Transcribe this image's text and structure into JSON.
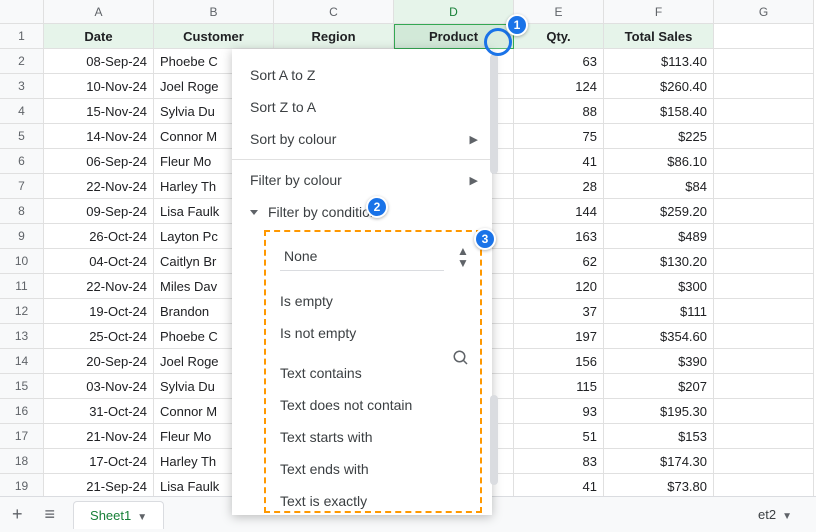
{
  "columns": [
    "A",
    "B",
    "C",
    "D",
    "E",
    "F",
    "G"
  ],
  "headers": {
    "date": "Date",
    "customer": "Customer",
    "region": "Region",
    "product": "Product",
    "qty": "Qty.",
    "total": "Total Sales"
  },
  "rows": [
    {
      "n": 2,
      "date": "08-Sep-24",
      "cust": "Phoebe C",
      "qty": 63,
      "total": "$113.40"
    },
    {
      "n": 3,
      "date": "10-Nov-24",
      "cust": "Joel Roge",
      "qty": 124,
      "total": "$260.40"
    },
    {
      "n": 4,
      "date": "15-Nov-24",
      "cust": "Sylvia Du",
      "qty": 88,
      "total": "$158.40"
    },
    {
      "n": 5,
      "date": "14-Nov-24",
      "cust": "Connor M",
      "qty": 75,
      "total": "$225"
    },
    {
      "n": 6,
      "date": "06-Sep-24",
      "cust": "Fleur Mo",
      "qty": 41,
      "total": "$86.10"
    },
    {
      "n": 7,
      "date": "22-Nov-24",
      "cust": "Harley Th",
      "qty": 28,
      "total": "$84"
    },
    {
      "n": 8,
      "date": "09-Sep-24",
      "cust": "Lisa Faulk",
      "qty": 144,
      "total": "$259.20"
    },
    {
      "n": 9,
      "date": "26-Oct-24",
      "cust": "Layton Pc",
      "qty": 163,
      "total": "$489"
    },
    {
      "n": 10,
      "date": "04-Oct-24",
      "cust": "Caitlyn Br",
      "qty": 62,
      "total": "$130.20"
    },
    {
      "n": 11,
      "date": "22-Nov-24",
      "cust": "Miles Dav",
      "qty": 120,
      "total": "$300"
    },
    {
      "n": 12,
      "date": "19-Oct-24",
      "cust": "Brandon ",
      "qty": 37,
      "total": "$111"
    },
    {
      "n": 13,
      "date": "25-Oct-24",
      "cust": "Phoebe C",
      "qty": 197,
      "total": "$354.60"
    },
    {
      "n": 14,
      "date": "20-Sep-24",
      "cust": "Joel Roge",
      "qty": 156,
      "total": "$390"
    },
    {
      "n": 15,
      "date": "03-Nov-24",
      "cust": "Sylvia Du",
      "qty": 115,
      "total": "$207"
    },
    {
      "n": 16,
      "date": "31-Oct-24",
      "cust": "Connor M",
      "qty": 93,
      "total": "$195.30"
    },
    {
      "n": 17,
      "date": "21-Nov-24",
      "cust": "Fleur Mo",
      "qty": 51,
      "total": "$153"
    },
    {
      "n": 18,
      "date": "17-Oct-24",
      "cust": "Harley Th",
      "qty": 83,
      "total": "$174.30"
    },
    {
      "n": 19,
      "date": "21-Sep-24",
      "cust": "Lisa Faulk",
      "qty": 41,
      "total": "$73.80"
    }
  ],
  "panel": {
    "sortAZ": "Sort A to Z",
    "sortZA": "Sort Z to A",
    "sortColor": "Sort by colour",
    "filterColor": "Filter by colour",
    "filterCond": "Filter by condition",
    "cond": {
      "selected": "None",
      "opts": [
        "Is empty",
        "Is not empty",
        "Text contains",
        "Text does not contain",
        "Text starts with",
        "Text ends with",
        "Text is exactly"
      ]
    }
  },
  "tabs": {
    "sheet1": "Sheet1",
    "sheet2": "et2"
  },
  "bubbles": {
    "b1": "1",
    "b2": "2",
    "b3": "3"
  }
}
